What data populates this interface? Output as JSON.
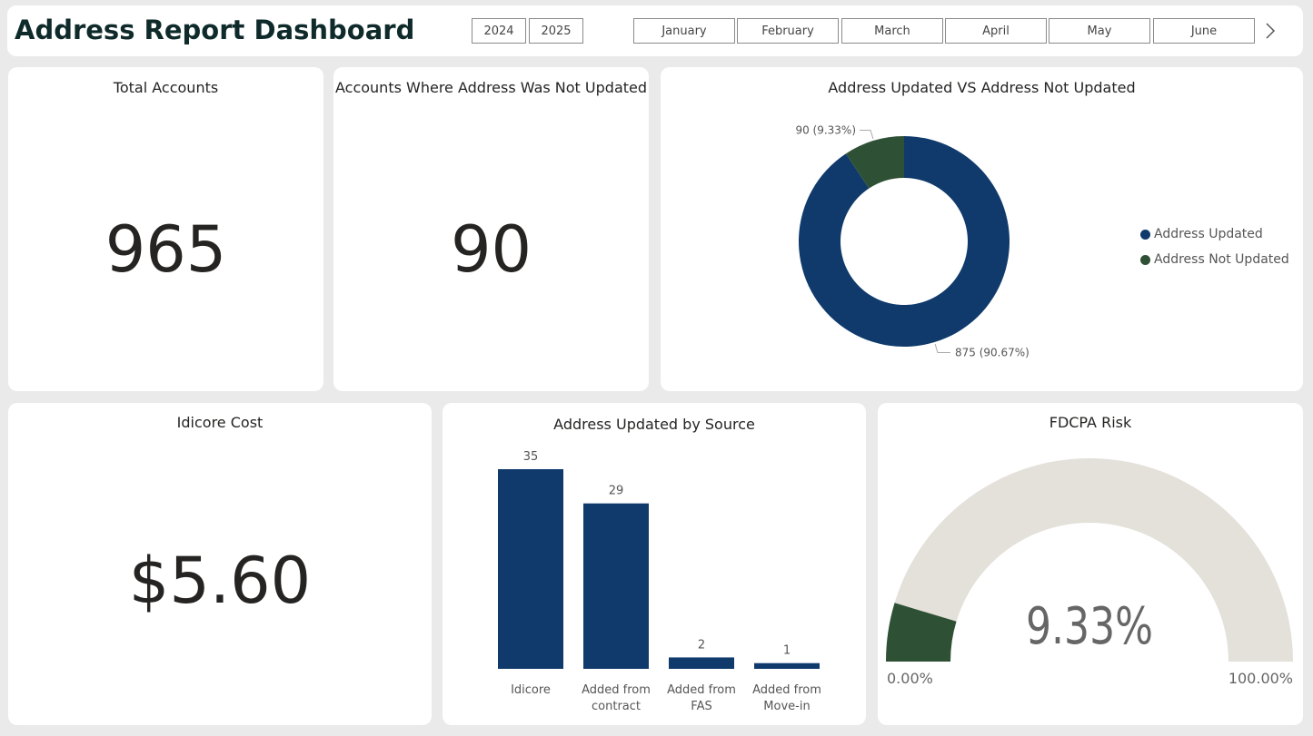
{
  "header": {
    "title": "Address Report Dashboard",
    "years": [
      "2024",
      "2025"
    ],
    "months": [
      "January",
      "February",
      "March",
      "April",
      "May",
      "June"
    ]
  },
  "total_accounts": {
    "title": "Total Accounts",
    "value": "965"
  },
  "not_updated": {
    "title": "Accounts Where Address Was Not Updated",
    "value": "90"
  },
  "idicore_cost": {
    "title": "Idicore Cost",
    "value": "$5.60"
  },
  "colors": {
    "navy": "#0f3a6b",
    "green": "#2e5135",
    "gauge_bg": "#e4e0da"
  },
  "chart_data": [
    {
      "type": "pie",
      "title": "Address Updated VS Address Not Updated",
      "series": [
        {
          "name": "Address Updated",
          "value": 875,
          "label": "875 (90.67%)",
          "color": "#0f3a6b"
        },
        {
          "name": "Address Not Updated",
          "value": 90,
          "label": "90 (9.33%)",
          "color": "#2e5135"
        }
      ],
      "legend": "right"
    },
    {
      "type": "bar",
      "title": "Address Updated by Source",
      "categories": [
        "Idicore",
        "Added from contract",
        "Added from FAS",
        "Added from Move-in"
      ],
      "category_lines": [
        [
          "Idicore"
        ],
        [
          "Added from",
          "contract"
        ],
        [
          "Added from",
          "FAS"
        ],
        [
          "Added from",
          "Move-in"
        ]
      ],
      "values": [
        35,
        29,
        2,
        1
      ],
      "ylim": [
        0,
        35
      ]
    },
    {
      "type": "gauge",
      "title": "FDCPA Risk",
      "value": 9.33,
      "value_label": "9.33%",
      "min_label": "0.00%",
      "max_label": "100.00%",
      "min": 0,
      "max": 100
    }
  ]
}
